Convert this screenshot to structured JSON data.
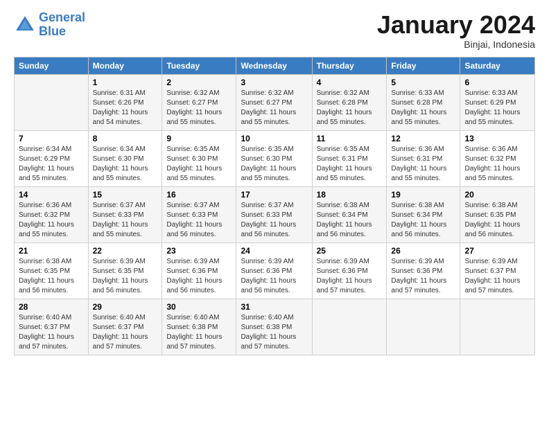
{
  "logo": {
    "line1": "General",
    "line2": "Blue"
  },
  "header": {
    "title": "January 2024",
    "subtitle": "Binjai, Indonesia"
  },
  "days_of_week": [
    "Sunday",
    "Monday",
    "Tuesday",
    "Wednesday",
    "Thursday",
    "Friday",
    "Saturday"
  ],
  "weeks": [
    [
      {
        "day": "",
        "sunrise": "",
        "sunset": "",
        "daylight": ""
      },
      {
        "day": "1",
        "sunrise": "Sunrise: 6:31 AM",
        "sunset": "Sunset: 6:26 PM",
        "daylight": "Daylight: 11 hours and 54 minutes."
      },
      {
        "day": "2",
        "sunrise": "Sunrise: 6:32 AM",
        "sunset": "Sunset: 6:27 PM",
        "daylight": "Daylight: 11 hours and 55 minutes."
      },
      {
        "day": "3",
        "sunrise": "Sunrise: 6:32 AM",
        "sunset": "Sunset: 6:27 PM",
        "daylight": "Daylight: 11 hours and 55 minutes."
      },
      {
        "day": "4",
        "sunrise": "Sunrise: 6:32 AM",
        "sunset": "Sunset: 6:28 PM",
        "daylight": "Daylight: 11 hours and 55 minutes."
      },
      {
        "day": "5",
        "sunrise": "Sunrise: 6:33 AM",
        "sunset": "Sunset: 6:28 PM",
        "daylight": "Daylight: 11 hours and 55 minutes."
      },
      {
        "day": "6",
        "sunrise": "Sunrise: 6:33 AM",
        "sunset": "Sunset: 6:29 PM",
        "daylight": "Daylight: 11 hours and 55 minutes."
      }
    ],
    [
      {
        "day": "7",
        "sunrise": "Sunrise: 6:34 AM",
        "sunset": "Sunset: 6:29 PM",
        "daylight": "Daylight: 11 hours and 55 minutes."
      },
      {
        "day": "8",
        "sunrise": "Sunrise: 6:34 AM",
        "sunset": "Sunset: 6:30 PM",
        "daylight": "Daylight: 11 hours and 55 minutes."
      },
      {
        "day": "9",
        "sunrise": "Sunrise: 6:35 AM",
        "sunset": "Sunset: 6:30 PM",
        "daylight": "Daylight: 11 hours and 55 minutes."
      },
      {
        "day": "10",
        "sunrise": "Sunrise: 6:35 AM",
        "sunset": "Sunset: 6:30 PM",
        "daylight": "Daylight: 11 hours and 55 minutes."
      },
      {
        "day": "11",
        "sunrise": "Sunrise: 6:35 AM",
        "sunset": "Sunset: 6:31 PM",
        "daylight": "Daylight: 11 hours and 55 minutes."
      },
      {
        "day": "12",
        "sunrise": "Sunrise: 6:36 AM",
        "sunset": "Sunset: 6:31 PM",
        "daylight": "Daylight: 11 hours and 55 minutes."
      },
      {
        "day": "13",
        "sunrise": "Sunrise: 6:36 AM",
        "sunset": "Sunset: 6:32 PM",
        "daylight": "Daylight: 11 hours and 55 minutes."
      }
    ],
    [
      {
        "day": "14",
        "sunrise": "Sunrise: 6:36 AM",
        "sunset": "Sunset: 6:32 PM",
        "daylight": "Daylight: 11 hours and 55 minutes."
      },
      {
        "day": "15",
        "sunrise": "Sunrise: 6:37 AM",
        "sunset": "Sunset: 6:33 PM",
        "daylight": "Daylight: 11 hours and 55 minutes."
      },
      {
        "day": "16",
        "sunrise": "Sunrise: 6:37 AM",
        "sunset": "Sunset: 6:33 PM",
        "daylight": "Daylight: 11 hours and 56 minutes."
      },
      {
        "day": "17",
        "sunrise": "Sunrise: 6:37 AM",
        "sunset": "Sunset: 6:33 PM",
        "daylight": "Daylight: 11 hours and 56 minutes."
      },
      {
        "day": "18",
        "sunrise": "Sunrise: 6:38 AM",
        "sunset": "Sunset: 6:34 PM",
        "daylight": "Daylight: 11 hours and 56 minutes."
      },
      {
        "day": "19",
        "sunrise": "Sunrise: 6:38 AM",
        "sunset": "Sunset: 6:34 PM",
        "daylight": "Daylight: 11 hours and 56 minutes."
      },
      {
        "day": "20",
        "sunrise": "Sunrise: 6:38 AM",
        "sunset": "Sunset: 6:35 PM",
        "daylight": "Daylight: 11 hours and 56 minutes."
      }
    ],
    [
      {
        "day": "21",
        "sunrise": "Sunrise: 6:38 AM",
        "sunset": "Sunset: 6:35 PM",
        "daylight": "Daylight: 11 hours and 56 minutes."
      },
      {
        "day": "22",
        "sunrise": "Sunrise: 6:39 AM",
        "sunset": "Sunset: 6:35 PM",
        "daylight": "Daylight: 11 hours and 56 minutes."
      },
      {
        "day": "23",
        "sunrise": "Sunrise: 6:39 AM",
        "sunset": "Sunset: 6:36 PM",
        "daylight": "Daylight: 11 hours and 56 minutes."
      },
      {
        "day": "24",
        "sunrise": "Sunrise: 6:39 AM",
        "sunset": "Sunset: 6:36 PM",
        "daylight": "Daylight: 11 hours and 56 minutes."
      },
      {
        "day": "25",
        "sunrise": "Sunrise: 6:39 AM",
        "sunset": "Sunset: 6:36 PM",
        "daylight": "Daylight: 11 hours and 57 minutes."
      },
      {
        "day": "26",
        "sunrise": "Sunrise: 6:39 AM",
        "sunset": "Sunset: 6:36 PM",
        "daylight": "Daylight: 11 hours and 57 minutes."
      },
      {
        "day": "27",
        "sunrise": "Sunrise: 6:39 AM",
        "sunset": "Sunset: 6:37 PM",
        "daylight": "Daylight: 11 hours and 57 minutes."
      }
    ],
    [
      {
        "day": "28",
        "sunrise": "Sunrise: 6:40 AM",
        "sunset": "Sunset: 6:37 PM",
        "daylight": "Daylight: 11 hours and 57 minutes."
      },
      {
        "day": "29",
        "sunrise": "Sunrise: 6:40 AM",
        "sunset": "Sunset: 6:37 PM",
        "daylight": "Daylight: 11 hours and 57 minutes."
      },
      {
        "day": "30",
        "sunrise": "Sunrise: 6:40 AM",
        "sunset": "Sunset: 6:38 PM",
        "daylight": "Daylight: 11 hours and 57 minutes."
      },
      {
        "day": "31",
        "sunrise": "Sunrise: 6:40 AM",
        "sunset": "Sunset: 6:38 PM",
        "daylight": "Daylight: 11 hours and 57 minutes."
      },
      {
        "day": "",
        "sunrise": "",
        "sunset": "",
        "daylight": ""
      },
      {
        "day": "",
        "sunrise": "",
        "sunset": "",
        "daylight": ""
      },
      {
        "day": "",
        "sunrise": "",
        "sunset": "",
        "daylight": ""
      }
    ]
  ]
}
